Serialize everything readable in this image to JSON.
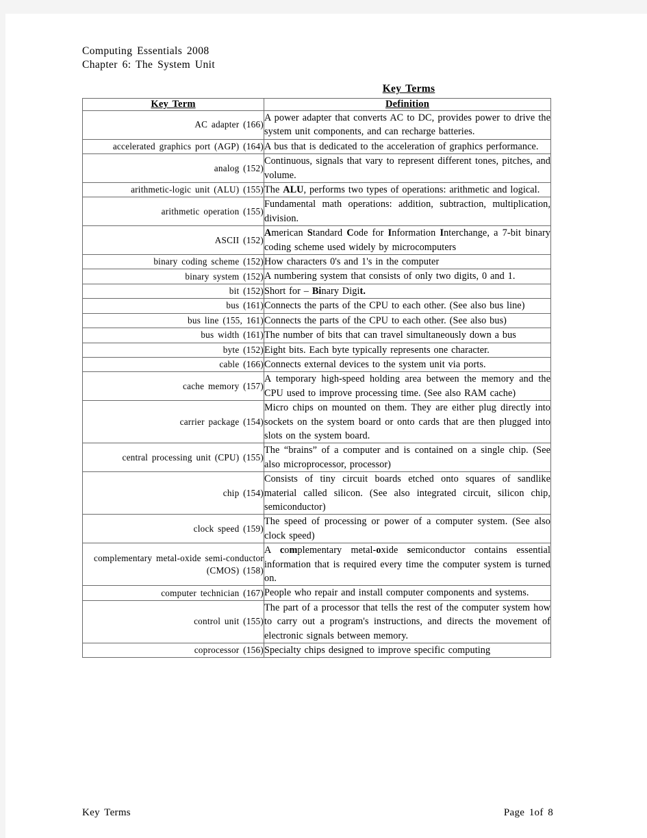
{
  "header": {
    "line1": "Computing Essentials 2008",
    "line2": "Chapter 6: The System Unit"
  },
  "title": "Key Terms",
  "table": {
    "columns": [
      "Key Term",
      "Definition"
    ],
    "rows": [
      {
        "term": "AC adapter (166)",
        "definition": "A power adapter that converts AC to DC, provides power to drive the system unit components, and can recharge batteries."
      },
      {
        "term": "accelerated graphics port (AGP) (164)",
        "definition": "A bus that is dedicated to the acceleration of graphics performance."
      },
      {
        "term": "analog (152)",
        "definition": "Continuous, signals that vary to represent different tones, pitches, and volume."
      },
      {
        "term": "arithmetic-logic unit (ALU) (155)",
        "definition": "The ALU, performs two types of operations: arithmetic and logical.",
        "bold_parts": [
          "ALU"
        ]
      },
      {
        "term": "arithmetic operation (155)",
        "definition": "Fundamental math operations: addition, subtraction, multiplication, division."
      },
      {
        "term": "ASCII (152)",
        "definition": "American Standard Code for Information Interchange, a 7-bit binary coding scheme used widely by microcomputers",
        "bold_parts": [
          "A",
          "S",
          "C",
          "I",
          "I"
        ]
      },
      {
        "term": "binary coding scheme (152)",
        "definition": "How characters 0's and 1's in the computer"
      },
      {
        "term": "binary system (152)",
        "definition": "A numbering system that consists of only two digits, 0 and 1."
      },
      {
        "term": "bit (152)",
        "definition": "Short for – Binary Digit.",
        "bold_parts": [
          "Bi",
          "t."
        ]
      },
      {
        "term": "bus (161)",
        "definition": "Connects the parts of the CPU to each other. (See also bus line)"
      },
      {
        "term": "bus line (155, 161)",
        "definition": "Connects the parts of the CPU to each other. (See also bus)"
      },
      {
        "term": "bus width (161)",
        "definition": "The number of bits that can travel simultaneously down a bus"
      },
      {
        "term": "byte (152)",
        "definition": "Eight bits.  Each byte typically represents one character."
      },
      {
        "term": "cable (166)",
        "definition": "Connects external devices to the system unit via ports."
      },
      {
        "term": "cache memory (157)",
        "definition": "A temporary high-speed holding area between the memory and the CPU used to improve processing time.  (See also RAM cache)"
      },
      {
        "term": "carrier package (154)",
        "definition": "Micro chips on mounted on them.  They are either plug directly into sockets on the system board or onto cards that are then plugged into slots on the system board."
      },
      {
        "term": "central processing unit (CPU) (155)",
        "definition": "The “brains” of a computer and is contained on a single chip. (See also microprocessor, processor)"
      },
      {
        "term": "chip (154)",
        "definition": "Consists of tiny circuit boards etched onto squares of sandlike material called silicon. (See also integrated circuit, silicon chip, semiconductor)"
      },
      {
        "term": "clock speed (159)",
        "definition": "The speed of processing or power of a computer system. (See also clock speed)"
      },
      {
        "term": "complementary metal-oxide semi-conductor (CMOS) (158)",
        "definition": "A complementary metal-oxide semiconductor contains essential information that is required every time the computer system is turned on.",
        "bold_parts": [
          "c",
          "m",
          "o",
          "s"
        ]
      },
      {
        "term": "computer technician (167)",
        "definition": "People who repair and install computer components and systems."
      },
      {
        "term": "control unit (155)",
        "definition": "The part of a processor that tells the rest of the computer system how to carry out a program's instructions, and directs the movement of electronic signals between memory."
      },
      {
        "term": "coprocessor (156)",
        "definition": "Specialty chips designed to improve specific computing"
      }
    ]
  },
  "footer": {
    "left": "Key Terms",
    "right": "Page 1of 8"
  }
}
